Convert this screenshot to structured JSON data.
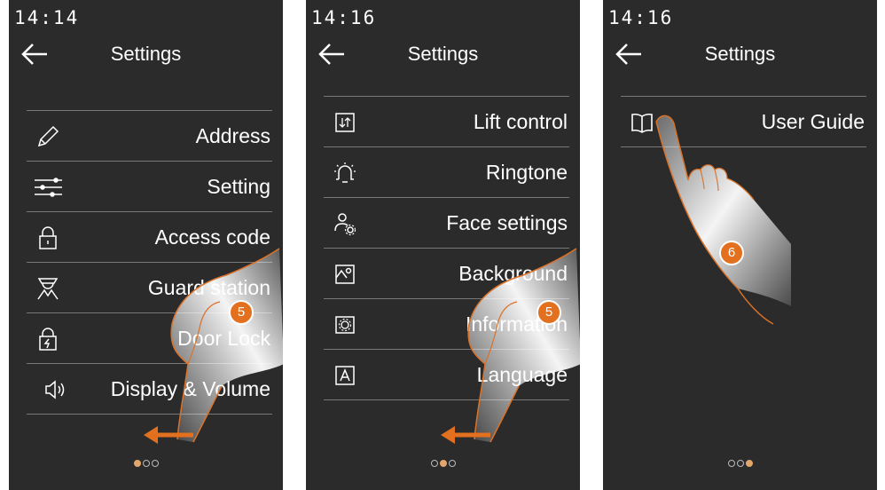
{
  "panels": [
    {
      "time": "14:14",
      "title": "Settings",
      "items": [
        {
          "label": "Address",
          "icon": "pencil-icon"
        },
        {
          "label": "Setting",
          "icon": "sliders-icon"
        },
        {
          "label": "Access code",
          "icon": "padlock-icon"
        },
        {
          "label": "Guard station",
          "icon": "guard-icon"
        },
        {
          "label": "Door Lock",
          "icon": "lock-lightning-icon"
        },
        {
          "label": "Display & Volume",
          "icon": "speaker-icon"
        }
      ],
      "page_index": 1,
      "page_count": 3,
      "callout": "5"
    },
    {
      "time": "14:16",
      "title": "Settings",
      "items": [
        {
          "label": "Lift control",
          "icon": "lift-icon"
        },
        {
          "label": "Ringtone",
          "icon": "bell-icon"
        },
        {
          "label": "Face settings",
          "icon": "face-settings-icon"
        },
        {
          "label": "Background",
          "icon": "background-icon"
        },
        {
          "label": "Information",
          "icon": "information-icon"
        },
        {
          "label": "Language",
          "icon": "language-icon"
        }
      ],
      "page_index": 2,
      "page_count": 3,
      "callout": "5"
    },
    {
      "time": "14:16",
      "title": "Settings",
      "items": [
        {
          "label": "User Guide",
          "icon": "book-icon"
        }
      ],
      "page_index": 3,
      "page_count": 3,
      "callout": "6"
    }
  ],
  "colors": {
    "screen_bg": "#2b2b2b",
    "divider": "#777777",
    "accent": "#e2701f",
    "active_dot": "#e3a66a"
  }
}
